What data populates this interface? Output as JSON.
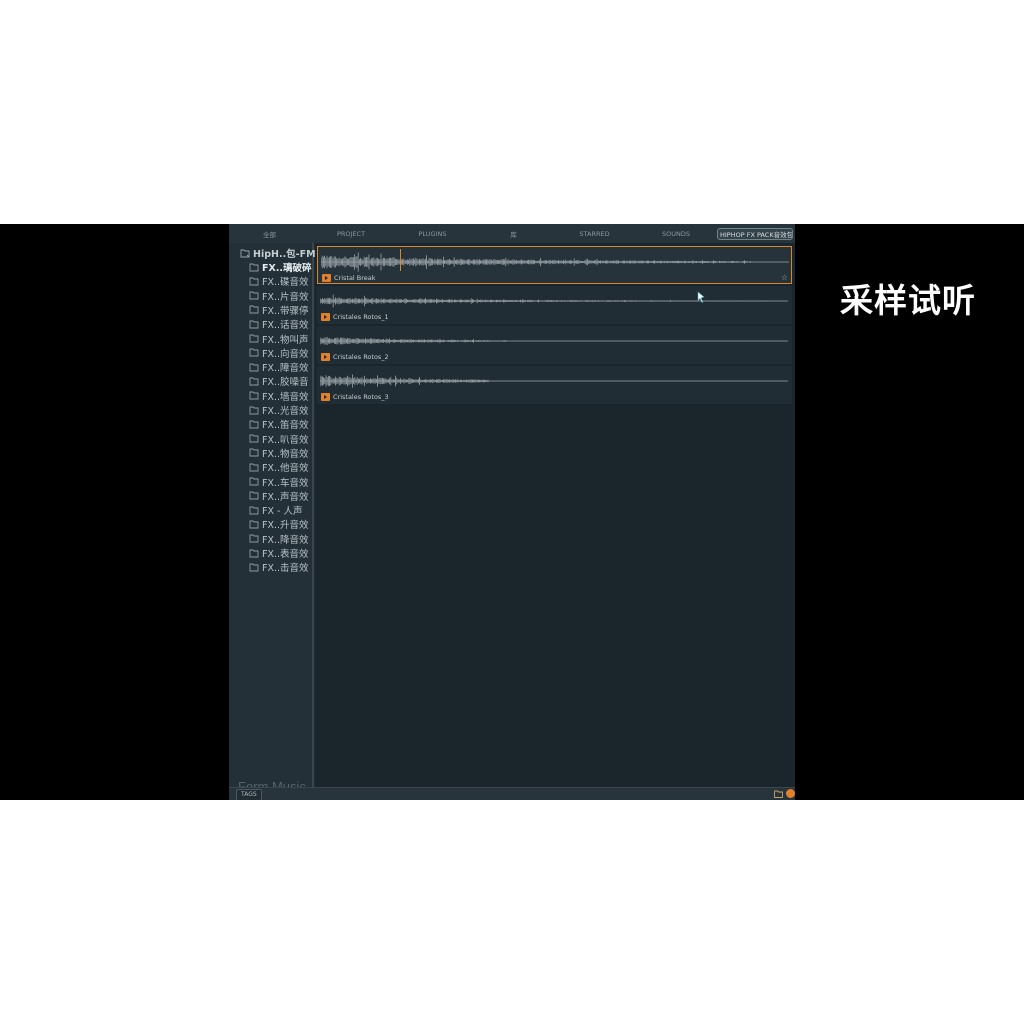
{
  "overlay": {
    "caption": "采样试听"
  },
  "tabs": [
    {
      "label": "全部",
      "active": false
    },
    {
      "label": "PROJECT",
      "active": false
    },
    {
      "label": "PLUGINS",
      "active": false
    },
    {
      "label": "库",
      "active": false
    },
    {
      "label": "STARRED",
      "active": false
    },
    {
      "label": "SOUNDS",
      "active": false
    },
    {
      "label": "HIPHOP FX PACK音效包...",
      "active": true
    }
  ],
  "sidebar": {
    "root": "HipH..包-FM",
    "items": [
      "FX..璃破碎",
      "FX..碟音效",
      "FX..片音效",
      "FX..带骤停",
      "FX..话音效",
      "FX..物叫声",
      "FX..向音效",
      "FX..障音效",
      "FX..胶噪音",
      "FX..墙音效",
      "FX..光音效",
      "FX..笛音效",
      "FX..叭音效",
      "FX..物音效",
      "FX..他音效",
      "FX..车音效",
      "FX..声音效",
      "FX - 人声",
      "FX..升音效",
      "FX..降音效",
      "FX..表音效",
      "FX..击音效"
    ],
    "selected_index": 0,
    "watermark": "Form Music"
  },
  "samples": [
    {
      "name": "Cristal Break",
      "selected": true,
      "starred": false,
      "star_icon": "star-outline-icon"
    },
    {
      "name": "Cristales Rotos_1",
      "selected": false
    },
    {
      "name": "Cristales Rotos_2",
      "selected": false
    },
    {
      "name": "Cristales Rotos_3",
      "selected": false
    }
  ],
  "statusbar": {
    "tags_label": "TAGS"
  },
  "colors": {
    "accent": "#e2812c",
    "selected_border": "#d9862f",
    "waveform": "#9aa3a8",
    "panel": "#1f2a31"
  }
}
